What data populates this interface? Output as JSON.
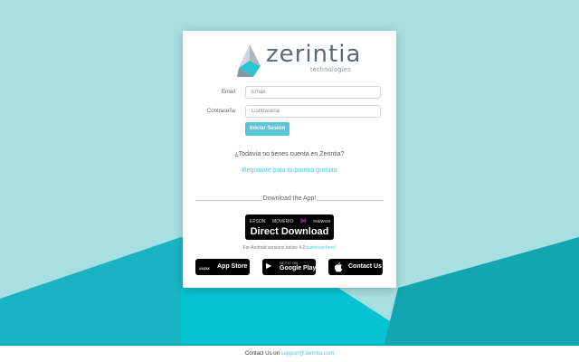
{
  "logo": {
    "name": "zerintia",
    "subtitle": "technologies"
  },
  "form": {
    "email_label": "Email",
    "email_placeholder": "Email",
    "password_label": "Contraseña",
    "password_placeholder": "Contraseña",
    "login_button": "Iniciar Sesión"
  },
  "signup": {
    "question": "¿Todavía no tienes cuenta en Zerintia?",
    "link": "Regístrate para tu prueba gratuita"
  },
  "download": {
    "heading": "Download the App!",
    "direct_brands": [
      "EPSON",
      "MOVERIO",
      "realwear"
    ],
    "direct_label": "Direct Download",
    "android_note": "For Android versions below 4.2",
    "android_link": "download here!",
    "app_store": {
      "small": "VUZIX",
      "label": "App Store"
    },
    "google_play": {
      "small": "GET IT ON",
      "label": "Google Play"
    },
    "contact": {
      "label": "Contact Us"
    }
  },
  "footer": {
    "text": "Contact Us on",
    "email": "support@zerintia.com"
  },
  "colors": {
    "background": "#a7dfe2",
    "accent": "#59c5d8",
    "dark_teal": "#1aa9b4"
  }
}
